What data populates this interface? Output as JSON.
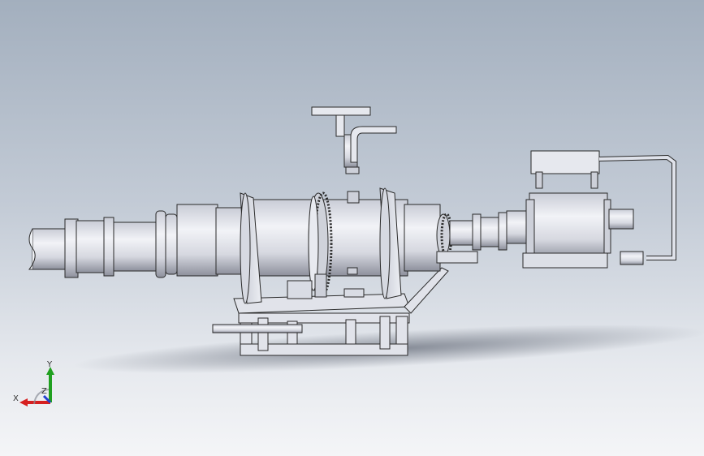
{
  "viewport": {
    "background_top": "#a3afbe",
    "background_bottom": "#f4f5f7",
    "model_fill": "#e4e6ec",
    "model_stroke": "#2a2a2a"
  },
  "triad": {
    "x_label": "X",
    "y_label": "Y",
    "z_label": "Z",
    "x_color": "#d62020",
    "y_color": "#20a020",
    "z_color": "#2040d0"
  }
}
